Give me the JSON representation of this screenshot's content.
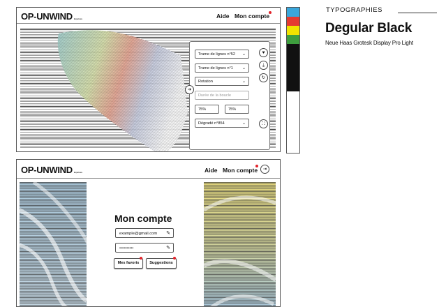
{
  "colors": {
    "accent_red": "#e2242b",
    "swatch_cyan": "#3aa7dc",
    "swatch_red": "#e53a31",
    "swatch_yellow": "#f1e300",
    "swatch_green": "#3e9e3e",
    "swatch_black": "#111111",
    "swatch_white": "#ffffff"
  },
  "screen1": {
    "logo": "OP-UNWIND",
    "logo_sub": "Experience",
    "nav_help": "Aide",
    "nav_account": "Mon compte",
    "controls": {
      "select_pattern_1": "Trame de lignes n°52",
      "select_pattern_2": "Trame de lignes n°1",
      "select_rotation": "Rotation",
      "loop_duration_placeholder": "Durée de la boucle",
      "value_left": "75%",
      "value_right": "75%",
      "select_gradient": "Dégradé n°854"
    },
    "icons": {
      "heart": "heart-icon",
      "download": "download-icon",
      "refresh": "refresh-icon",
      "collapse": "arrow-right-icon",
      "fullscreen": "fullscreen-icon"
    }
  },
  "screen2": {
    "logo": "OP-UNWIND",
    "logo_sub": "Experience",
    "nav_help": "Aide",
    "nav_account": "Mon compte",
    "account_title": "Mon compte",
    "email_value": "example@gmail.com",
    "password_value": "••••••••••",
    "btn_favorites": "Mes favoris",
    "btn_suggestions": "Suggestions",
    "icons": {
      "edit": "pencil-icon",
      "logout": "logout-icon"
    }
  },
  "typography": {
    "heading": "TYPOGRAPHIES",
    "font_primary": "Degular Black",
    "font_secondary": "Neue Haas Grotesk Display Pro Light"
  }
}
